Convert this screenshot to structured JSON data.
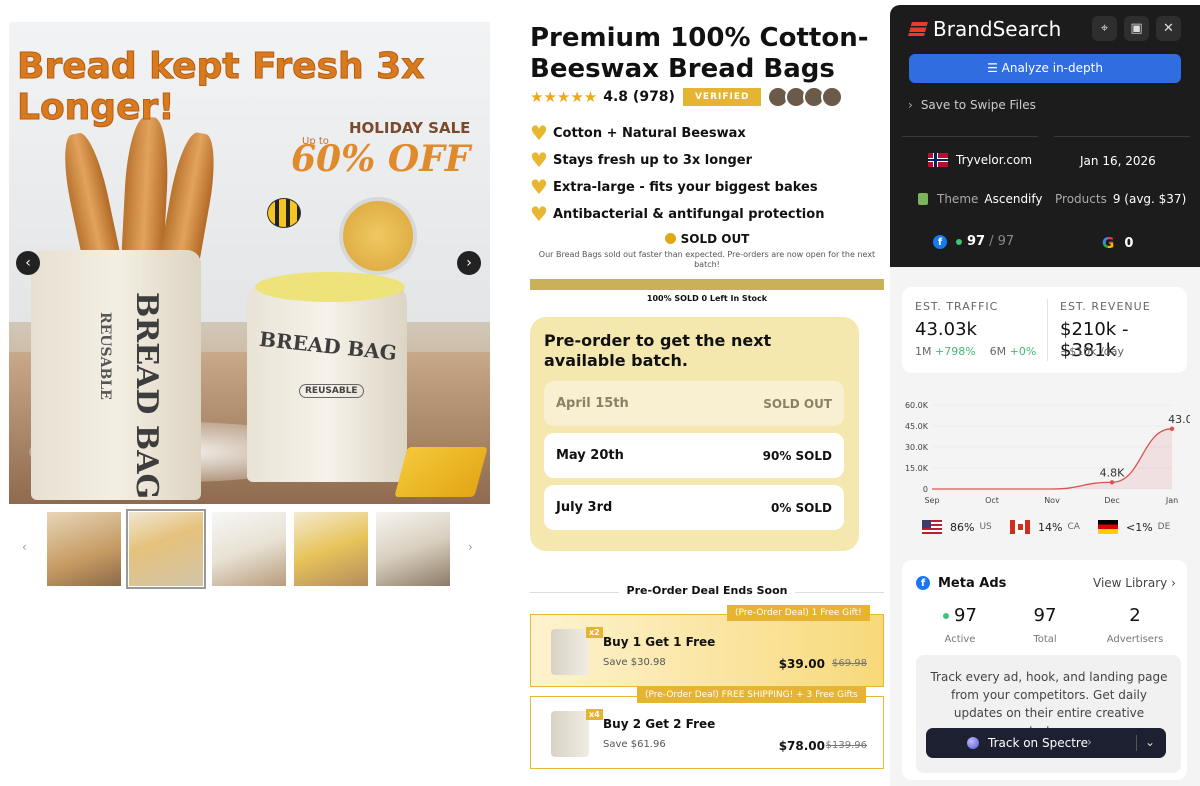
{
  "product": {
    "title": "Premium 100% Cotton-Beeswax Bread Bags",
    "stars": "★★★★★",
    "rating": "4.8 (978)",
    "verified": "VERIFIED",
    "features": [
      "Cotton + Natural Beeswax",
      "Stays fresh up to 3x longer",
      "Extra-large - fits your biggest bakes",
      "Antibacterial & antifungal protection"
    ],
    "sold_out": "SOLD OUT",
    "sold_out_note": "Our Bread Bags sold out faster than expected. Pre-orders are now open for the next batch!",
    "stock_text": "100% SOLD 0 Left In Stock",
    "stock_sold_fraction": 1.0
  },
  "gallery": {
    "headline": "Bread kept Fresh 3x Longer!",
    "sale_upto": "Up to",
    "sale_title": "HOLIDAY SALE",
    "sale_off": "60% OFF",
    "bag_text_vertical": "BREAD BAG",
    "bag_text_reusable": "REUSABLE",
    "bag2_text": "BREAD BAG",
    "bag2_sub": "REUSABLE",
    "prev_icon": "chevron-left-icon",
    "next_icon": "chevron-right-icon",
    "thumb_count": 5,
    "selected_thumb": 2
  },
  "preorder": {
    "title": "Pre-order to get the next available batch.",
    "batches": [
      {
        "date": "April 15th",
        "status": "SOLD OUT"
      },
      {
        "date": "May 20th",
        "status": "90% SOLD"
      },
      {
        "date": "July 3rd",
        "status": "0% SOLD"
      }
    ]
  },
  "deals": {
    "header": "Pre-Order Deal Ends Soon",
    "offers": [
      {
        "tag": "(Pre-Order Deal) 1 Free Gift!",
        "qty": "x2",
        "name": "Buy 1 Get 1 Free",
        "save": "Save $30.98",
        "price": "$39.00",
        "old": "$69.98"
      },
      {
        "tag": "(Pre-Order Deal) FREE SHIPPING! + 3 Free Gifts",
        "qty": "x4",
        "name": "Buy 2 Get 2 Free",
        "save": "Save $61.96",
        "price": "$78.00",
        "old": "$139.96"
      }
    ]
  },
  "ext": {
    "brand": "BrandSearch",
    "pin_icon": "pin-icon",
    "layout_icon": "layout-icon",
    "close_icon": "close-icon",
    "analyze": "Analyze in-depth",
    "swipe": "Save to Swipe Files",
    "site": "Tryvelor.com",
    "date": "Jan 16, 2026",
    "theme_label": "Theme",
    "theme": "Ascendify",
    "products_label": "Products",
    "products": "9 (avg. $37)",
    "fb_active": "97",
    "fb_total": "/ 97",
    "google": "0",
    "traffic_label": "EST. TRAFFIC",
    "traffic": "43.03k",
    "traffic_1m_label": "1M",
    "traffic_1m": "+798%",
    "traffic_6m_label": "6M",
    "traffic_6m": "+0%",
    "revenue_label": "EST. REVENUE",
    "revenue": "$210k - $381k",
    "revenue_day": "~$10k /day",
    "geo": [
      {
        "pct": "86%",
        "code": "US"
      },
      {
        "pct": "14%",
        "code": "CA"
      },
      {
        "pct": "<1%",
        "code": "DE"
      }
    ],
    "meta_title": "Meta Ads",
    "view_library": "View Library",
    "meta_active": "97",
    "meta_active_lbl": "Active",
    "meta_total": "97",
    "meta_total_lbl": "Total",
    "meta_adv": "2",
    "meta_adv_lbl": "Advertisers",
    "track_text": "Track every ad, hook, and landing page from your competitors. Get daily updates on their entire creative strategy.",
    "spectre": "Track on Spectre"
  },
  "chart_data": {
    "type": "area",
    "categories": [
      "Sep",
      "Oct",
      "Nov",
      "Dec",
      "Jan"
    ],
    "values": [
      0,
      0,
      0,
      4800,
      43000
    ],
    "point_labels": [
      "",
      "",
      "",
      "4.8K",
      "43.0K"
    ],
    "y_ticks": [
      "0",
      "15.0K",
      "30.0K",
      "45.0K",
      "60.0K"
    ],
    "ylim": [
      0,
      60000
    ],
    "grid": true
  }
}
